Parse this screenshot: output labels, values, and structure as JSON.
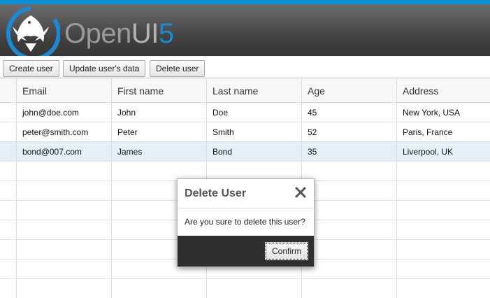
{
  "app": {
    "brand_open": "Open",
    "brand_ui": "UI",
    "brand_five": "5",
    "logo_icon": "openui5-phoenix-logo"
  },
  "toolbar": {
    "create_label": "Create user",
    "update_label": "Update user's data",
    "delete_label": "Delete user"
  },
  "table": {
    "columns": [
      "Email",
      "First name",
      "Last name",
      "Age",
      "Address"
    ],
    "rows": [
      {
        "email": "john@doe.com",
        "first": "John",
        "last": "Doe",
        "age": "45",
        "address": "New York, USA"
      },
      {
        "email": "peter@smith.com",
        "first": "Peter",
        "last": "Smith",
        "age": "52",
        "address": "Paris, France"
      },
      {
        "email": "bond@007.com",
        "first": "James",
        "last": "Bond",
        "age": "35",
        "address": "Liverpool, UK"
      }
    ],
    "selected_row": 2
  },
  "dialog": {
    "title": "Delete User",
    "message": "Are you sure to delete this user?",
    "confirm_label": "Confirm",
    "close_icon": "close-icon"
  },
  "colors": {
    "accent": "#0a8fd8",
    "header_dark": "#3f3f3f",
    "selected_row": "#e4f0f8",
    "dialog_footer": "#2f2f2f"
  }
}
